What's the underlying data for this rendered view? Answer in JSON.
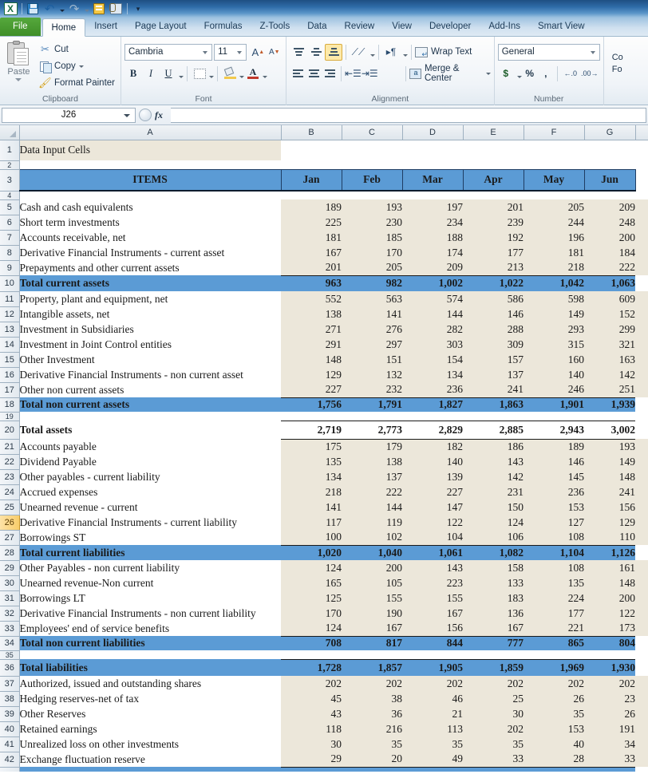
{
  "app": {
    "quick_access": [
      {
        "name": "excel-logo",
        "label": "X"
      },
      {
        "name": "save-icon",
        "label": "Save"
      },
      {
        "name": "undo-icon",
        "label": "Undo"
      },
      {
        "name": "redo-icon",
        "label": "Redo"
      },
      {
        "name": "note-icon",
        "label": "New Comment"
      },
      {
        "name": "attach-icon",
        "label": "Attach"
      },
      {
        "name": "customize-qat-icon",
        "label": "Customize Quick Access Toolbar"
      }
    ]
  },
  "ribbon": {
    "tabs": [
      {
        "label": "File",
        "active": false,
        "file": true
      },
      {
        "label": "Home",
        "active": true
      },
      {
        "label": "Insert",
        "active": false
      },
      {
        "label": "Page Layout",
        "active": false
      },
      {
        "label": "Formulas",
        "active": false
      },
      {
        "label": "Z-Tools",
        "active": false
      },
      {
        "label": "Data",
        "active": false
      },
      {
        "label": "Review",
        "active": false
      },
      {
        "label": "View",
        "active": false
      },
      {
        "label": "Developer",
        "active": false
      },
      {
        "label": "Add-Ins",
        "active": false
      },
      {
        "label": "Smart View",
        "active": false
      }
    ],
    "clipboard": {
      "group_label": "Clipboard",
      "paste": "Paste",
      "cut": "Cut",
      "copy": "Copy",
      "format_painter": "Format Painter"
    },
    "font": {
      "group_label": "Font",
      "font_name": "Cambria",
      "font_size": "11",
      "bold": "B",
      "italic": "I",
      "underline": "U",
      "grow_font": "A",
      "shrink_font": "A"
    },
    "alignment": {
      "group_label": "Alignment",
      "wrap_text": "Wrap Text",
      "merge_center": "Merge & Center"
    },
    "number": {
      "group_label": "Number",
      "format": "General",
      "currency": "$",
      "percent": "%",
      "comma": ",",
      "increase_decimal": ".00",
      "decrease_decimal": ".00"
    },
    "styles": {
      "conditional_formatting_line1": "Co",
      "conditional_formatting_line2": "Fo"
    }
  },
  "formula_bar": {
    "name_box": "J26",
    "fx": "fx",
    "formula": ""
  },
  "sheet": {
    "columns": [
      "A",
      "B",
      "C",
      "D",
      "E",
      "F",
      "G"
    ],
    "months": [
      "Jan",
      "Feb",
      "Mar",
      "Apr",
      "May",
      "Jun"
    ],
    "items_header": "ITEMS",
    "title_cell": "Data Input Cells",
    "selected_row": 26,
    "colors": {
      "accent_blue": "#5b9bd5",
      "input_beige": "#ece7da",
      "selected_row_header": "#f8cd6b"
    },
    "rows": [
      {
        "n": 1,
        "type": "title",
        "label": "Data Input Cells",
        "values": []
      },
      {
        "n": 2,
        "type": "collapsed",
        "label": "",
        "values": []
      },
      {
        "n": 3,
        "type": "header",
        "label": "ITEMS",
        "values": [
          "Jan",
          "Feb",
          "Mar",
          "Apr",
          "May",
          "Jun"
        ]
      },
      {
        "n": 4,
        "type": "collapsed",
        "label": "",
        "values": []
      },
      {
        "n": 5,
        "type": "data",
        "label": "Cash and cash equivalents",
        "values": [
          "189",
          "193",
          "197",
          "201",
          "205",
          "209"
        ]
      },
      {
        "n": 6,
        "type": "data",
        "label": "Short term investments",
        "values": [
          "225",
          "230",
          "234",
          "239",
          "244",
          "248"
        ]
      },
      {
        "n": 7,
        "type": "data",
        "label": "Accounts receivable, net",
        "values": [
          "181",
          "185",
          "188",
          "192",
          "196",
          "200"
        ]
      },
      {
        "n": 8,
        "type": "data",
        "label": "Derivative Financial Instruments - current asset",
        "values": [
          "167",
          "170",
          "174",
          "177",
          "181",
          "184"
        ]
      },
      {
        "n": 9,
        "type": "data",
        "label": "Prepayments and other current assets",
        "values": [
          "201",
          "205",
          "209",
          "213",
          "218",
          "222"
        ]
      },
      {
        "n": 10,
        "type": "total",
        "label": "Total current assets",
        "values": [
          "963",
          "982",
          "1,002",
          "1,022",
          "1,042",
          "1,063"
        ]
      },
      {
        "n": 11,
        "type": "data",
        "label": "Property, plant and equipment, net",
        "values": [
          "552",
          "563",
          "574",
          "586",
          "598",
          "609"
        ]
      },
      {
        "n": 12,
        "type": "data",
        "label": "Intangible assets, net",
        "values": [
          "138",
          "141",
          "144",
          "146",
          "149",
          "152"
        ]
      },
      {
        "n": 13,
        "type": "data",
        "label": "Investment in Subsidiaries",
        "values": [
          "271",
          "276",
          "282",
          "288",
          "293",
          "299"
        ]
      },
      {
        "n": 14,
        "type": "data",
        "label": "Investment in Joint Control entities",
        "values": [
          "291",
          "297",
          "303",
          "309",
          "315",
          "321"
        ]
      },
      {
        "n": 15,
        "type": "data",
        "label": "Other Investment",
        "values": [
          "148",
          "151",
          "154",
          "157",
          "160",
          "163"
        ]
      },
      {
        "n": 16,
        "type": "data",
        "label": "Derivative Financial Instruments - non current asset",
        "values": [
          "129",
          "132",
          "134",
          "137",
          "140",
          "142"
        ]
      },
      {
        "n": 17,
        "type": "data",
        "label": "Other non current assets",
        "values": [
          "227",
          "232",
          "236",
          "241",
          "246",
          "251"
        ]
      },
      {
        "n": 18,
        "type": "total",
        "label": "Total non current assets",
        "values": [
          "1,756",
          "1,791",
          "1,827",
          "1,863",
          "1,901",
          "1,939"
        ]
      },
      {
        "n": 19,
        "type": "collapsed",
        "label": "",
        "values": []
      },
      {
        "n": 20,
        "type": "grand",
        "label": "Total assets",
        "values": [
          "2,719",
          "2,773",
          "2,829",
          "2,885",
          "2,943",
          "3,002"
        ]
      },
      {
        "n": 21,
        "type": "data",
        "label": "Accounts payable",
        "values": [
          "175",
          "179",
          "182",
          "186",
          "189",
          "193"
        ]
      },
      {
        "n": 22,
        "type": "data",
        "label": "Dividend Payable",
        "values": [
          "135",
          "138",
          "140",
          "143",
          "146",
          "149"
        ]
      },
      {
        "n": 23,
        "type": "data",
        "label": "Other payables - current liability",
        "values": [
          "134",
          "137",
          "139",
          "142",
          "145",
          "148"
        ]
      },
      {
        "n": 24,
        "type": "data",
        "label": "Accrued expenses",
        "values": [
          "218",
          "222",
          "227",
          "231",
          "236",
          "241"
        ]
      },
      {
        "n": 25,
        "type": "data",
        "label": "Unearned revenue - current",
        "values": [
          "141",
          "144",
          "147",
          "150",
          "153",
          "156"
        ]
      },
      {
        "n": 26,
        "type": "data",
        "label": "Derivative Financial Instruments - current liability",
        "values": [
          "117",
          "119",
          "122",
          "124",
          "127",
          "129"
        ]
      },
      {
        "n": 27,
        "type": "data",
        "label": "Borrowings ST",
        "values": [
          "100",
          "102",
          "104",
          "106",
          "108",
          "110"
        ]
      },
      {
        "n": 28,
        "type": "total",
        "label": "Total current liabilities",
        "values": [
          "1,020",
          "1,040",
          "1,061",
          "1,082",
          "1,104",
          "1,126"
        ]
      },
      {
        "n": 29,
        "type": "data",
        "label": "Other Payables - non current liability",
        "values": [
          "124",
          "200",
          "143",
          "158",
          "108",
          "161"
        ]
      },
      {
        "n": 30,
        "type": "data",
        "label": "Unearned revenue-Non current",
        "values": [
          "165",
          "105",
          "223",
          "133",
          "135",
          "148"
        ]
      },
      {
        "n": 31,
        "type": "data",
        "label": "Borrowings LT",
        "values": [
          "125",
          "155",
          "155",
          "183",
          "224",
          "200"
        ]
      },
      {
        "n": 32,
        "type": "data",
        "label": "Derivative Financial Instruments - non current liability",
        "values": [
          "170",
          "190",
          "167",
          "136",
          "177",
          "122"
        ]
      },
      {
        "n": 33,
        "type": "data",
        "label": "Employees' end of service benefits",
        "values": [
          "124",
          "167",
          "156",
          "167",
          "221",
          "173"
        ]
      },
      {
        "n": 34,
        "type": "total",
        "label": "Total non current liabilities",
        "values": [
          "708",
          "817",
          "844",
          "777",
          "865",
          "804"
        ]
      },
      {
        "n": 35,
        "type": "collapsed",
        "label": "",
        "values": []
      },
      {
        "n": 36,
        "type": "total",
        "label": "Total liabilities",
        "values": [
          "1,728",
          "1,857",
          "1,905",
          "1,859",
          "1,969",
          "1,930"
        ]
      },
      {
        "n": 37,
        "type": "data",
        "label": "Authorized, issued and outstanding shares",
        "values": [
          "202",
          "202",
          "202",
          "202",
          "202",
          "202"
        ]
      },
      {
        "n": 38,
        "type": "data",
        "label": "Hedging reserves-net of tax",
        "values": [
          "45",
          "38",
          "46",
          "25",
          "26",
          "23"
        ]
      },
      {
        "n": 39,
        "type": "data",
        "label": "Other Reserves",
        "values": [
          "43",
          "36",
          "21",
          "30",
          "35",
          "26"
        ]
      },
      {
        "n": 40,
        "type": "data",
        "label": "Retained earnings",
        "values": [
          "118",
          "216",
          "113",
          "202",
          "153",
          "191"
        ]
      },
      {
        "n": 41,
        "type": "data",
        "label": "Unrealized loss on other investments",
        "values": [
          "30",
          "35",
          "35",
          "35",
          "40",
          "34"
        ]
      },
      {
        "n": 42,
        "type": "data",
        "label": "Exchange fluctuation reserve",
        "values": [
          "29",
          "20",
          "49",
          "33",
          "28",
          "33"
        ]
      }
    ]
  }
}
